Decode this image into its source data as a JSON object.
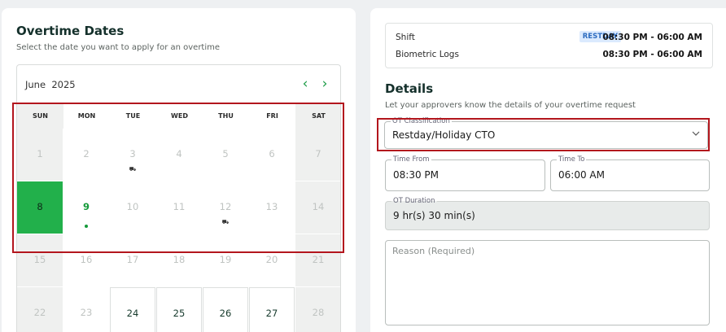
{
  "overtime_dates": {
    "title": "Overtime Dates",
    "subtitle": "Select the date you want to apply for an overtime"
  },
  "calendar": {
    "month": "June",
    "year": "2025",
    "prev_icon": "chevron-left-icon",
    "next_icon": "chevron-right-icon",
    "weekdays": [
      "SUN",
      "MON",
      "TUE",
      "WED",
      "THU",
      "FRI",
      "SAT"
    ],
    "days": [
      "1",
      "2",
      "3",
      "4",
      "5",
      "6",
      "7",
      "8",
      "9",
      "10",
      "11",
      "12",
      "13",
      "14",
      "15",
      "16",
      "17",
      "18",
      "19",
      "20",
      "21",
      "22",
      "23",
      "24",
      "25",
      "26",
      "27",
      "28"
    ],
    "selected_day": "8",
    "today_day": "9",
    "event_icon": "⛟",
    "icon_days": [
      "3",
      "12"
    ],
    "available_days": [
      "24",
      "25",
      "26",
      "27"
    ]
  },
  "shift_info": {
    "shift_label": "Shift",
    "restday_badge": "RESTDAY",
    "shift_value": "08:30 PM - 06:00 AM",
    "biometric_label": "Biometric Logs",
    "biometric_value": "08:30 PM - 06:00 AM"
  },
  "details": {
    "title": "Details",
    "subtitle": "Let your approvers know the details of your overtime request",
    "ot_classification": {
      "label": "OT Classification",
      "value": "Restday/Holiday CTO"
    },
    "time_from": {
      "label": "Time From",
      "value": "08:30 PM"
    },
    "time_to": {
      "label": "Time To",
      "value": "06:00 AM"
    },
    "ot_duration": {
      "label": "OT Duration",
      "value": "9 hr(s) 30 min(s)"
    },
    "reason": {
      "placeholder": "Reason (Required)"
    }
  },
  "colors": {
    "accent_green": "#22b04b",
    "highlight_red": "#b3161d",
    "badge_blue": "#2d6cc0"
  }
}
